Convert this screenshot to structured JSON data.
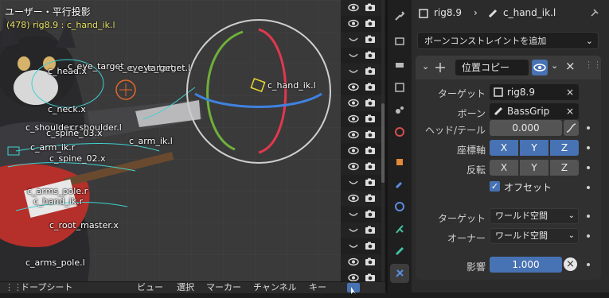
{
  "viewport": {
    "title": "ユーザー・平行投影",
    "subtitle": "(478) rig8.9 : c_hand_ik.l",
    "bone_labels": [
      "c_head.x",
      "c_eye_target",
      "c_eye_target.l",
      "c_eye_target.r",
      "c_hand_ik.l",
      "c_neck.x",
      "c_shoulder.r",
      "c_shoulder.l",
      "c_spine_03.x",
      "c_arm_ik.r",
      "c_arm_ik.l",
      "c_spine_02.x",
      "c_arms_pole.r",
      "c_hand_ik.r",
      "c_root_master.x",
      "c_arms_pole.l"
    ]
  },
  "outliner": {
    "rows": 18
  },
  "properties": {
    "breadcrumb": {
      "object": "rig8.9",
      "bone": "c_hand_ik.l"
    },
    "add_constraint": "ボーンコンストレイントを追加",
    "constraint": {
      "name": "位置コピー",
      "target_label": "ターゲット",
      "target_value": "rig8.9",
      "bone_label": "ボーン",
      "bone_value": "BassGrip",
      "headtail_label": "ヘッド/テール",
      "headtail_value": "0.000",
      "axis_label": "座標軸",
      "invert_label": "反転",
      "axes": [
        "X",
        "Y",
        "Z"
      ],
      "offset_label": "オフセット",
      "target_space_label": "ターゲット",
      "target_space_value": "ワールド空間",
      "owner_space_label": "オーナー",
      "owner_space_value": "ワールド空間",
      "influence_label": "影響",
      "influence_value": "1.000"
    }
  },
  "timeline": {
    "editor": "ドープシート",
    "menus": [
      "ビュー",
      "選択",
      "マーカー",
      "チャンネル",
      "キー"
    ]
  },
  "colors": {
    "accent": "#4772b3",
    "gizmo_x": "#e0384f",
    "gizmo_y": "#6fb03a",
    "gizmo_z": "#3f82e0"
  }
}
